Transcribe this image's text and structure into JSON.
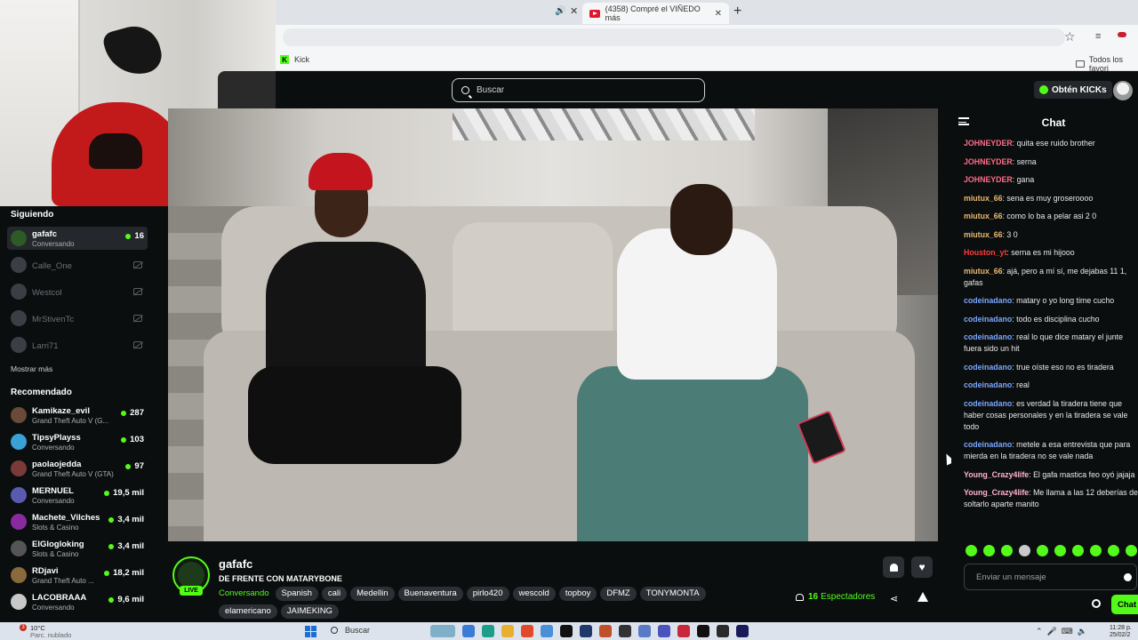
{
  "browser": {
    "tab_title": "(4358) Compré el VIÑEDO más",
    "bookmark_kick": "Kick",
    "bookmark_all": "Todos los favori"
  },
  "topbar": {
    "search_placeholder": "Buscar",
    "kicks_button": "Obtén KICKs"
  },
  "sidebar": {
    "following_title": "Siguiendo",
    "following": [
      {
        "name": "gafafc",
        "sub": "Conversando",
        "count": "16",
        "live": true
      },
      {
        "name": "Calle_One",
        "live": false
      },
      {
        "name": "Westcol",
        "live": false
      },
      {
        "name": "MrStivenTc",
        "live": false
      },
      {
        "name": "Larri71",
        "live": false
      }
    ],
    "show_more": "Mostrar más",
    "recommended_title": "Recomendado",
    "recommended": [
      {
        "name": "Kamikaze_evil",
        "sub": "Grand Theft Auto V (G...",
        "count": "287"
      },
      {
        "name": "TipsyPlayss",
        "sub": "Conversando",
        "count": "103"
      },
      {
        "name": "paolaojedda",
        "sub": "Grand Theft Auto V (GTA)",
        "count": "97"
      },
      {
        "name": "MERNUEL",
        "sub": "Conversando",
        "count": "19,5 mil"
      },
      {
        "name": "Machete_Vilches",
        "sub": "Slots & Casino",
        "count": "3,4 mil"
      },
      {
        "name": "ElGlogloking",
        "sub": "Slots & Casino",
        "count": "3,4 mil"
      },
      {
        "name": "RDjavi",
        "sub": "Grand Theft Auto ...",
        "count": "18,2 mil"
      },
      {
        "name": "LACOBRAAA",
        "sub": "Conversando",
        "count": "9,6 mil"
      }
    ]
  },
  "stream": {
    "streamer": "gafafc",
    "live_label": "LIVE",
    "title": "DE FRENTE CON MATARYBONE",
    "category": "Conversando",
    "tags": [
      "Spanish",
      "cali",
      "Medellin",
      "Buenaventura",
      "pirlo420",
      "wescold",
      "topboy",
      "DFMZ",
      "TONYMONTA",
      "elamericano",
      "JAIMEKING"
    ],
    "viewers": "16",
    "viewers_label": "Espectadores"
  },
  "chat": {
    "title": "Chat",
    "messages": [
      {
        "user": "JOHNEYDER",
        "color": "#ff6b8a",
        "text": "quita ese ruido brother"
      },
      {
        "user": "JOHNEYDER",
        "color": "#ff6b8a",
        "text": "serna"
      },
      {
        "user": "JOHNEYDER",
        "color": "#ff6b8a",
        "text": "gana"
      },
      {
        "user": "miutux_66",
        "color": "#e9b872",
        "text": "sena es muy groseroooo"
      },
      {
        "user": "miutux_66",
        "color": "#e9b872",
        "text": "como lo ba a pelar asi 2 0"
      },
      {
        "user": "miutux_66",
        "color": "#e9b872",
        "text": "3 0"
      },
      {
        "user": "Houston_yt",
        "color": "#ff3b3b",
        "text": "serna es mi hijooo"
      },
      {
        "user": "miutux_66",
        "color": "#e9b872",
        "text": "ajá, pero a mí sí, me dejabas 11 1, gafas"
      },
      {
        "user": "codeinadano",
        "color": "#7aa7ff",
        "text": "matary o yo long time cucho"
      },
      {
        "user": "codeinadano",
        "color": "#7aa7ff",
        "text": "todo es disciplina cucho"
      },
      {
        "user": "codeinadano",
        "color": "#7aa7ff",
        "text": "real lo que dice matary el junte fuera sido un hit"
      },
      {
        "user": "codeinadano",
        "color": "#7aa7ff",
        "text": "true oíste eso no es tiradera"
      },
      {
        "user": "codeinadano",
        "color": "#7aa7ff",
        "text": "real"
      },
      {
        "user": "codeinadano",
        "color": "#7aa7ff",
        "text": "es verdad la tiradera tiene que haber cosas personales y en la tiradera se vale todo"
      },
      {
        "user": "codeinadano",
        "color": "#7aa7ff",
        "text": "metele a esa entrevista que para mierda en la tiradera no se vale nada"
      },
      {
        "user": "Young_Crazy4life",
        "color": "#ffb4d0",
        "text": "El gafa mastica feo oyó jajaja"
      },
      {
        "user": "Young_Crazy4life",
        "color": "#ffb4d0",
        "text": "Me llama a las 12 deberías de soltarlo aparte manito"
      }
    ],
    "input_placeholder": "Enviar un mensaje",
    "send_button": "Chat"
  },
  "taskbar": {
    "notification_count": "3",
    "weather_temp": "10°C",
    "weather_desc": "Parc. nublado",
    "search_label": "Buscar",
    "time": "11:28 p.",
    "date": "25/02/2"
  },
  "colors": {
    "kick_green": "#53fc18",
    "background": "#0b0e0f"
  }
}
